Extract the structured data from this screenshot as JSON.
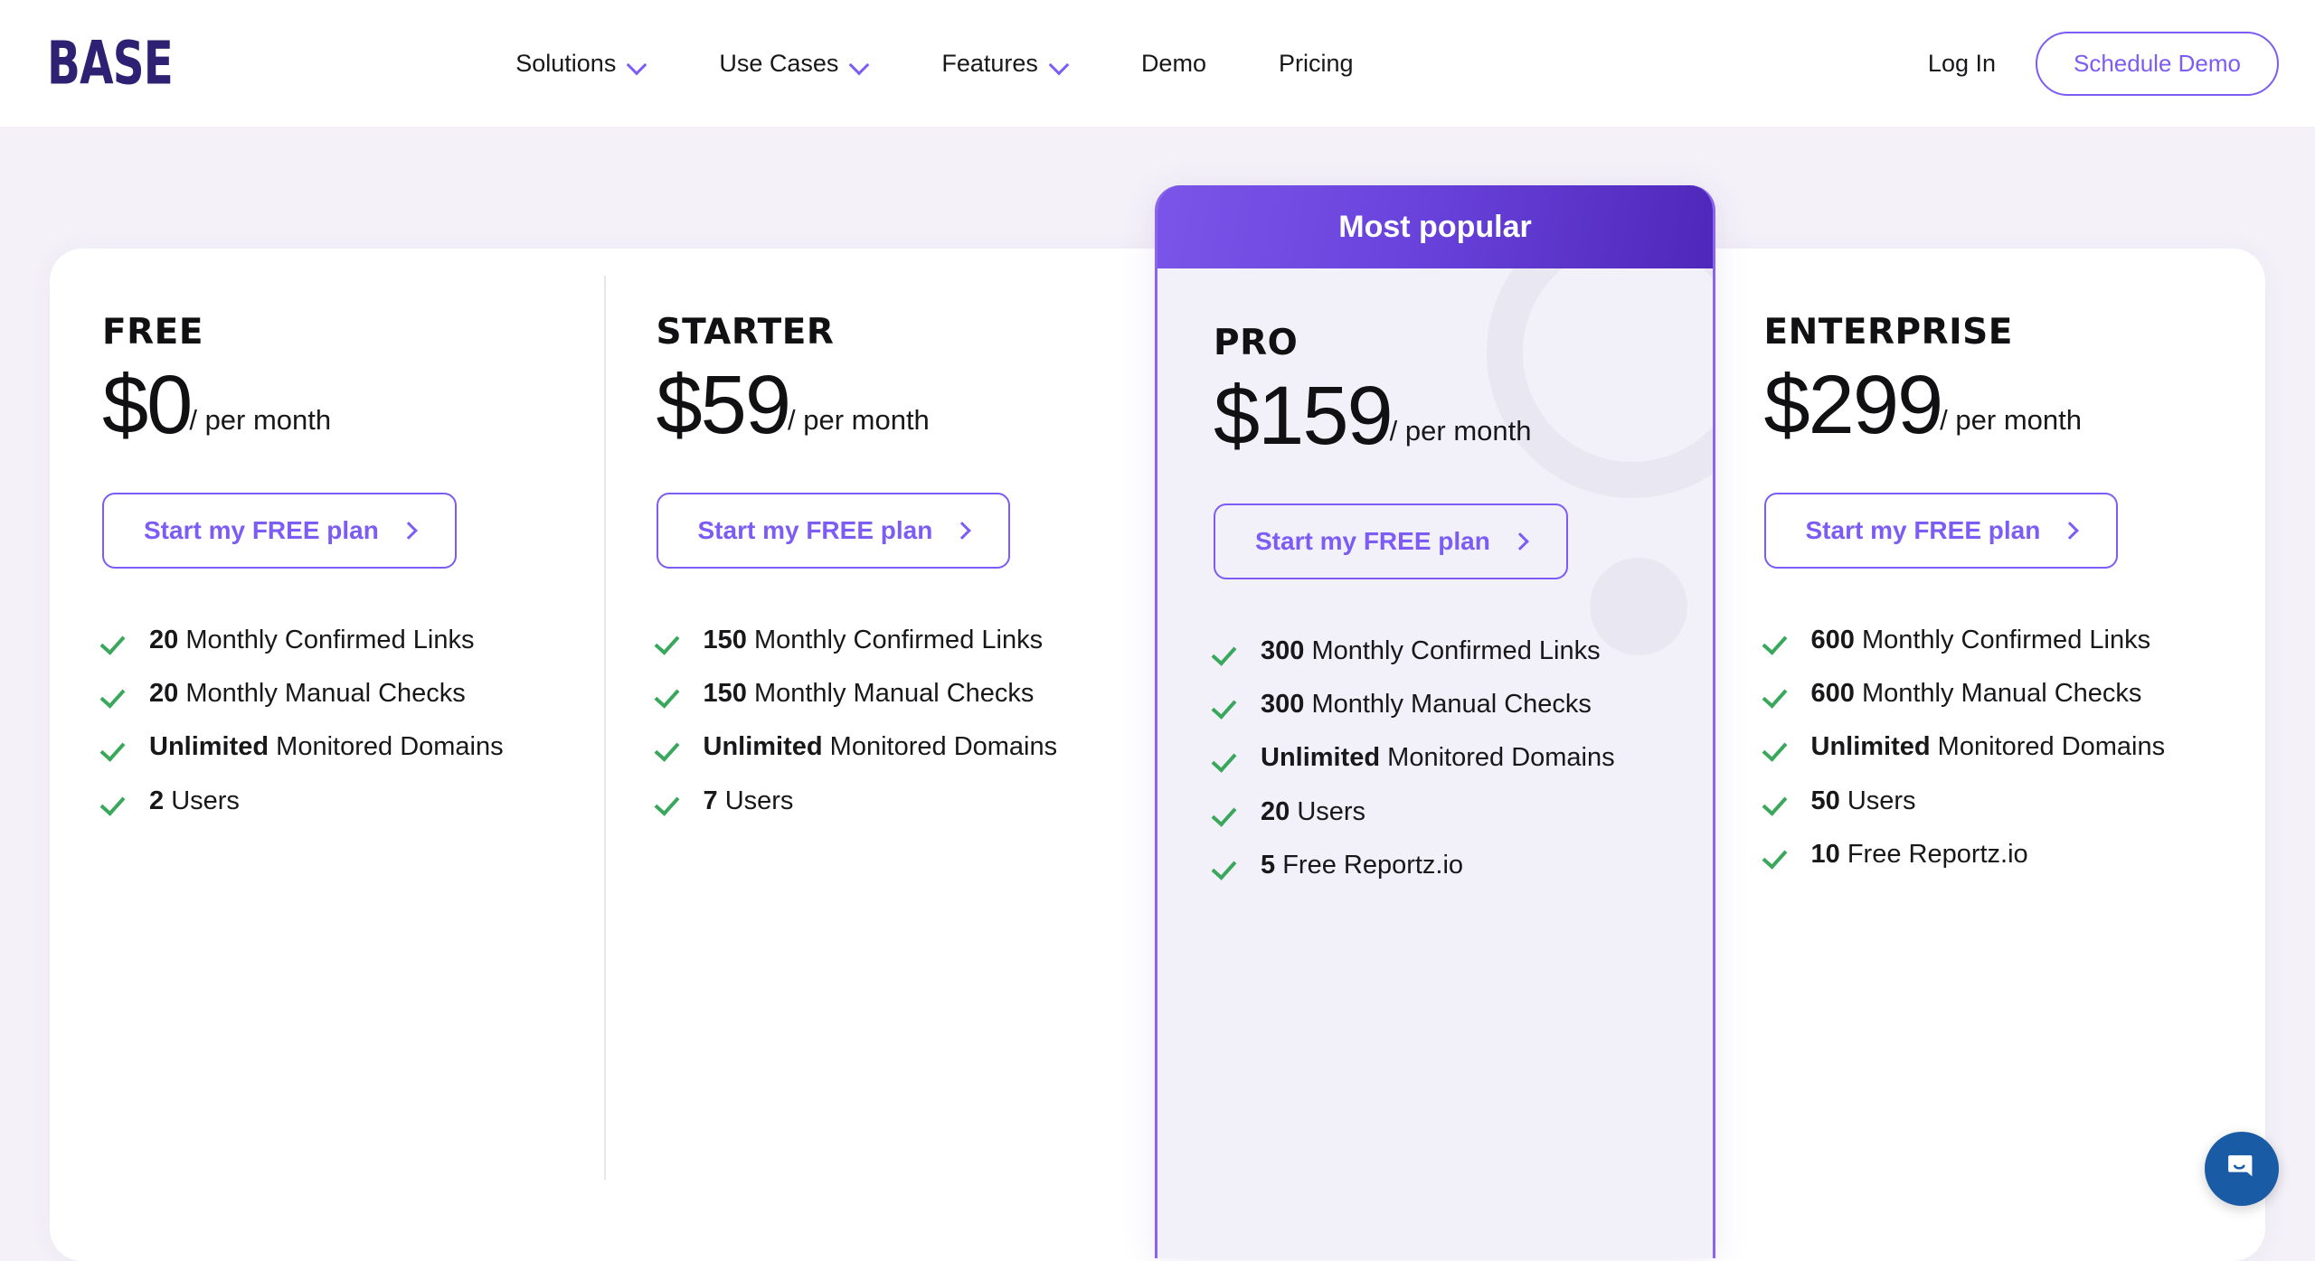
{
  "header": {
    "logo_text": "BASE",
    "nav_items": [
      {
        "label": "Solutions",
        "has_chevron": true
      },
      {
        "label": "Use Cases",
        "has_chevron": true
      },
      {
        "label": "Features",
        "has_chevron": true
      },
      {
        "label": "Demo",
        "has_chevron": false
      },
      {
        "label": "Pricing",
        "has_chevron": false
      }
    ],
    "login_label": "Log In",
    "schedule_demo_label": "Schedule Demo"
  },
  "colors": {
    "brand_purple": "#7c5cf5",
    "logo_purple": "#2e2073",
    "gradient_start": "#7b55e9",
    "gradient_end": "#4f27ba",
    "check_green": "#3aa85c",
    "page_background": "#f4f1f8",
    "card_background": "#ffffff",
    "pro_background": "#f2f0f8",
    "chat_blue": "#1a5ba6"
  },
  "icons": {
    "chevron_down": "chevron-down-icon",
    "arrow_right": "chevron-right-icon",
    "check": "check-icon",
    "chat": "chat-bubble-icon"
  },
  "plans": [
    {
      "name": "FREE",
      "price": "$0",
      "period": "/ per month",
      "cta_label": "Start my FREE plan",
      "highlighted": false,
      "features": [
        {
          "value": "20",
          "text": " Monthly Confirmed Links"
        },
        {
          "value": "20",
          "text": " Monthly Manual Checks"
        },
        {
          "value": "Unlimited",
          "text": " Monitored Domains"
        },
        {
          "value": "2",
          "text": " Users"
        }
      ]
    },
    {
      "name": "STARTER",
      "price": "$59",
      "period": "/ per month",
      "cta_label": "Start my FREE plan",
      "highlighted": false,
      "features": [
        {
          "value": "150",
          "text": " Monthly Confirmed Links"
        },
        {
          "value": "150",
          "text": " Monthly Manual Checks"
        },
        {
          "value": "Unlimited",
          "text": " Monitored Domains"
        },
        {
          "value": "7",
          "text": " Users"
        }
      ]
    },
    {
      "name": "PRO",
      "price": "$159",
      "period": "/ per month",
      "cta_label": "Start my FREE plan",
      "highlighted": true,
      "badge": "Most popular",
      "features": [
        {
          "value": "300",
          "text": " Monthly Confirmed Links"
        },
        {
          "value": "300",
          "text": " Monthly Manual Checks"
        },
        {
          "value": "Unlimited",
          "text": " Monitored Domains"
        },
        {
          "value": "20",
          "text": " Users"
        },
        {
          "value": "5",
          "text": " Free Reportz.io"
        }
      ]
    },
    {
      "name": "ENTERPRISE",
      "price": "$299",
      "period": "/ per month",
      "cta_label": "Start my FREE plan",
      "highlighted": false,
      "features": [
        {
          "value": "600",
          "text": " Monthly Confirmed Links"
        },
        {
          "value": "600",
          "text": " Monthly Manual Checks"
        },
        {
          "value": "Unlimited",
          "text": " Monitored Domains"
        },
        {
          "value": "50",
          "text": " Users"
        },
        {
          "value": "10",
          "text": " Free Reportz.io"
        }
      ]
    }
  ]
}
